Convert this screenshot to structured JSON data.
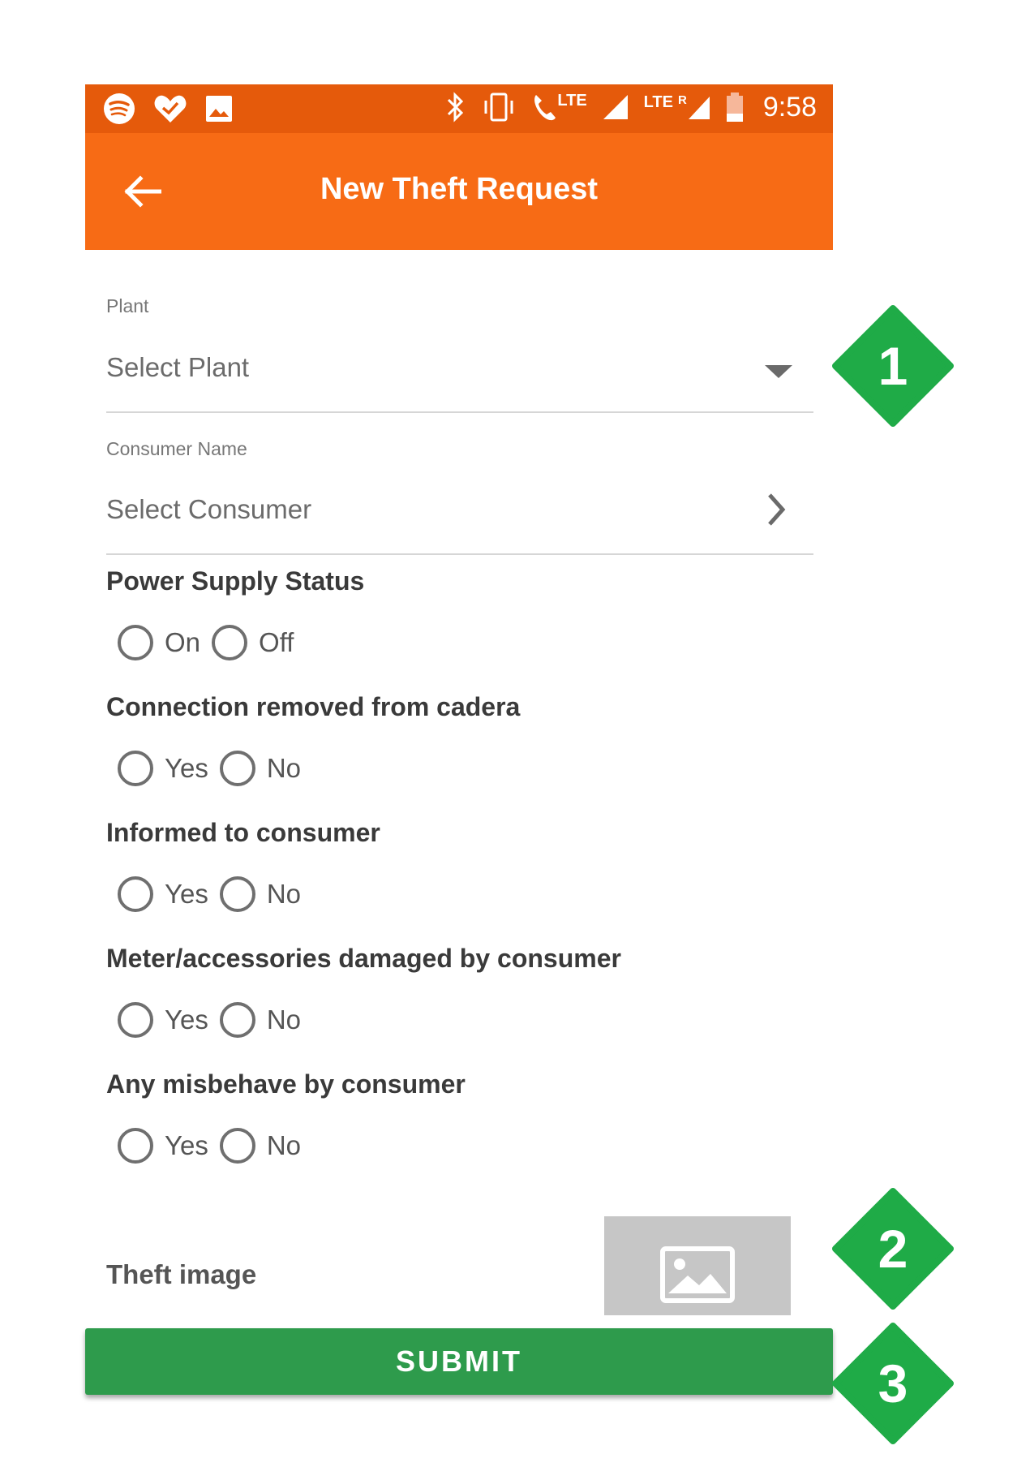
{
  "status_bar": {
    "time": "9:58",
    "network_label_1": "LTE",
    "network_label_2": "LTE",
    "roaming_label": "R",
    "left_icons": [
      "spotify-icon",
      "heart-check-icon",
      "image-icon"
    ],
    "right_icons": [
      "bluetooth-icon",
      "vibrate-icon",
      "wifi-calling-icon",
      "signal-icon",
      "signal-roaming-icon",
      "battery-icon"
    ]
  },
  "toolbar": {
    "title": "New Theft Request",
    "back_icon": "arrow-left-icon"
  },
  "form": {
    "plant": {
      "label": "Plant",
      "value": "Select Plant"
    },
    "consumer": {
      "label": "Consumer Name",
      "value": "Select Consumer"
    },
    "power_supply": {
      "title": "Power Supply Status",
      "options": [
        "On",
        "Off"
      ]
    },
    "connection_removed": {
      "title": "Connection removed from cadera",
      "options": [
        "Yes",
        "No"
      ]
    },
    "informed": {
      "title": "Informed to consumer",
      "options": [
        "Yes",
        "No"
      ]
    },
    "meter_damaged": {
      "title": "Meter/accessories damaged by consumer",
      "options": [
        "Yes",
        "No"
      ]
    },
    "misbehave": {
      "title": "Any misbehave by consumer",
      "options": [
        "Yes",
        "No"
      ]
    },
    "theft_image": {
      "label": "Theft image",
      "placeholder_icon": "image-placeholder-icon"
    },
    "submit_label": "SUBMIT"
  },
  "annotations": {
    "badge_1": "1",
    "badge_2": "2",
    "badge_3": "3",
    "badge_color": "#1fab47"
  },
  "colors": {
    "status_bar": "#e55a0b",
    "toolbar": "#f76b15",
    "submit": "#2e9b4c"
  }
}
